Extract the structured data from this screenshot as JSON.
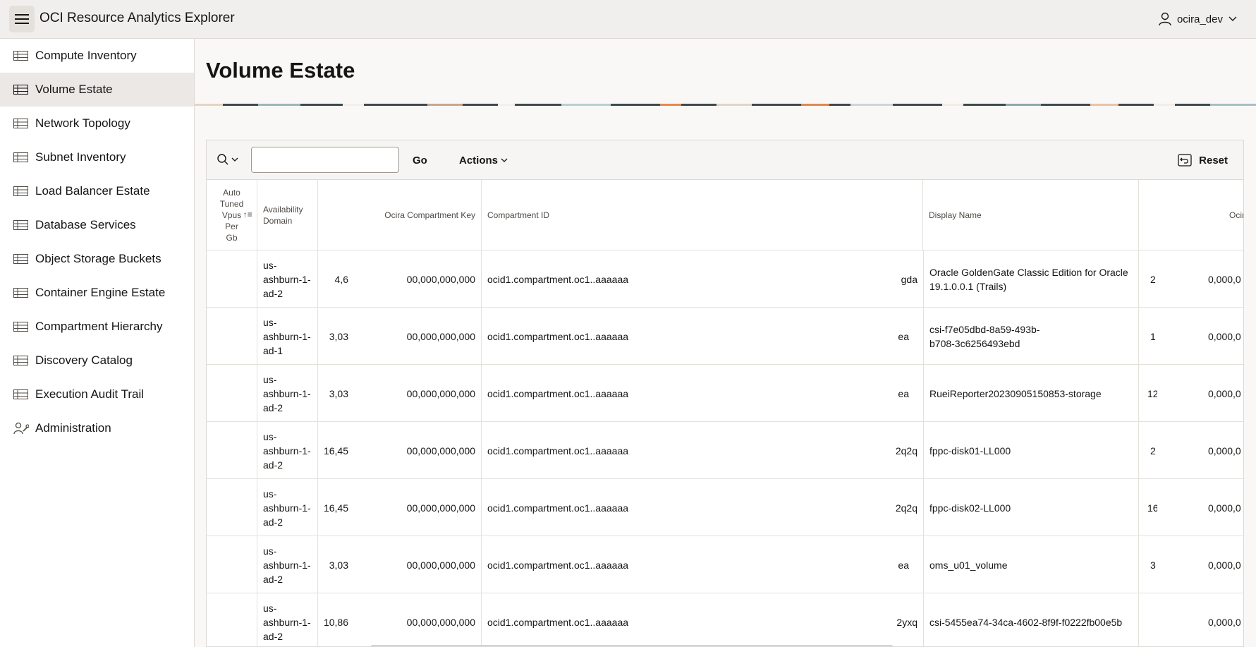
{
  "app": {
    "title": "OCI Resource Analytics Explorer",
    "user": "ocira_dev"
  },
  "sidebar": {
    "items": [
      {
        "label": "Compute Inventory",
        "icon": "table-icon"
      },
      {
        "label": "Volume Estate",
        "icon": "table-icon",
        "active": true
      },
      {
        "label": "Network Topology",
        "icon": "table-icon"
      },
      {
        "label": "Subnet Inventory",
        "icon": "table-icon"
      },
      {
        "label": "Load Balancer Estate",
        "icon": "table-icon"
      },
      {
        "label": "Database Services",
        "icon": "table-icon"
      },
      {
        "label": "Object Storage Buckets",
        "icon": "table-icon"
      },
      {
        "label": "Container Engine Estate",
        "icon": "table-icon"
      },
      {
        "label": "Compartment Hierarchy",
        "icon": "table-icon"
      },
      {
        "label": "Discovery Catalog",
        "icon": "table-icon"
      },
      {
        "label": "Execution Audit Trail",
        "icon": "table-icon"
      },
      {
        "label": "Administration",
        "icon": "wrench-person-icon"
      }
    ]
  },
  "page": {
    "title": "Volume Estate"
  },
  "toolbar": {
    "search_value": "",
    "go_label": "Go",
    "actions_label": "Actions",
    "reset_label": "Reset"
  },
  "table": {
    "headers": {
      "auto_tuned": [
        "Auto",
        "Tuned",
        "Vpus",
        "Per",
        "Gb"
      ],
      "availability_domain": [
        "Availability",
        "Domain"
      ],
      "ocira_compartment_key": "Ocira Compartment Key",
      "compartment_id": "Compartment ID",
      "display_name": "Display Name",
      "ocir_partial": "Ocir"
    },
    "rows": [
      {
        "ad": [
          "us-",
          "ashburn-1-",
          "ad-2"
        ],
        "size": "4,6",
        "key": "00,000,000,000",
        "compartment": "ocid1.compartment.oc1..aaaaaa",
        "tail": "gda",
        "name": [
          "Oracle GoldenGate Classic Edition for Oracle",
          "19.1.0.0.1 (Trails)"
        ],
        "extra": "2",
        "ocir": "0,000,0"
      },
      {
        "ad": [
          "us-",
          "ashburn-1-",
          "ad-1"
        ],
        "size": "3,03",
        "key": "00,000,000,000",
        "compartment": "ocid1.compartment.oc1..aaaaaa",
        "tail": "ea",
        "name": [
          "csi-f7e05dbd-8a59-493b-",
          "b708-3c6256493ebd"
        ],
        "extra": "1",
        "ocir": "0,000,0"
      },
      {
        "ad": [
          "us-",
          "ashburn-1-",
          "ad-2"
        ],
        "size": "3,03",
        "key": "00,000,000,000",
        "compartment": "ocid1.compartment.oc1..aaaaaa",
        "tail": "ea",
        "name": [
          "RueiReporter20230905150853-storage"
        ],
        "extra": "12",
        "ocir": "0,000,0"
      },
      {
        "ad": [
          "us-",
          "ashburn-1-",
          "ad-2"
        ],
        "size": "16,45",
        "key": "00,000,000,000",
        "compartment": "ocid1.compartment.oc1..aaaaaa",
        "tail": "2q2q",
        "name": [
          "fppc-disk01-LL000"
        ],
        "extra": "2",
        "ocir": "0,000,0"
      },
      {
        "ad": [
          "us-",
          "ashburn-1-",
          "ad-2"
        ],
        "size": "16,45",
        "key": "00,000,000,000",
        "compartment": "ocid1.compartment.oc1..aaaaaa",
        "tail": "2q2q",
        "name": [
          "fppc-disk02-LL000"
        ],
        "extra": "16",
        "ocir": "0,000,0"
      },
      {
        "ad": [
          "us-",
          "ashburn-1-",
          "ad-2"
        ],
        "size": "3,03",
        "key": "00,000,000,000",
        "compartment": "ocid1.compartment.oc1..aaaaaa",
        "tail": "ea",
        "name": [
          "oms_u01_volume"
        ],
        "extra": "3",
        "ocir": "0,000,0"
      },
      {
        "ad": [
          "us-",
          "ashburn-1-",
          "ad-2"
        ],
        "size": "10,86",
        "key": "00,000,000,000",
        "compartment": "ocid1.compartment.oc1..aaaaaa",
        "tail": "2yxq",
        "name": [
          "csi-5455ea74-34ca-4602-8f9f-f0222fb00e5b"
        ],
        "extra": "",
        "ocir": "0,000,0"
      }
    ]
  },
  "colors": {
    "header_bg": "#f1efed",
    "active_nav": "#ebe8e5",
    "border": "#dcd9d6"
  }
}
